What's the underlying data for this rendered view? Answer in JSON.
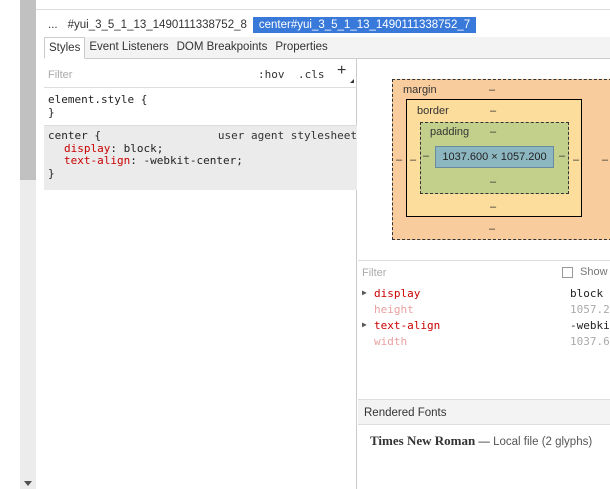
{
  "breadcrumbs": {
    "ellipsis": "...",
    "items": [
      {
        "label": "#yui_3_5_1_13_1490111338752_8"
      },
      {
        "label": "center#yui_3_5_1_13_1490111338752_7"
      }
    ]
  },
  "tabs": [
    {
      "label": "Styles"
    },
    {
      "label": "Event Listeners"
    },
    {
      "label": "DOM Breakpoints"
    },
    {
      "label": "Properties"
    }
  ],
  "styles": {
    "filter_placeholder": "Filter",
    "hov_label": ":hov",
    "cls_label": ".cls",
    "plus_label": "+",
    "element_style": {
      "selector": "element.style {",
      "close": "}"
    },
    "rule": {
      "selector": "center {",
      "origin": "user agent stylesheet",
      "props": [
        {
          "name": "display",
          "value": "block;"
        },
        {
          "name": "text-align",
          "value": "-webkit-center;"
        }
      ],
      "close": "}"
    }
  },
  "box_model": {
    "margin_label": "margin",
    "border_label": "border",
    "padding_label": "padding",
    "dash": "–",
    "content": "1037.600 × 1057.200"
  },
  "computed": {
    "filter_placeholder": "Filter",
    "show_all_label": "Show",
    "rows": [
      {
        "name": "display",
        "value": "block"
      },
      {
        "name": "height",
        "value": "1057.2"
      },
      {
        "name": "text-align",
        "value": "-webki"
      },
      {
        "name": "width",
        "value": "1037.6"
      }
    ]
  },
  "rendered_fonts": {
    "title": "Rendered Fonts",
    "font_name": "Times New Roman",
    "separator": " — ",
    "source": "Local file ",
    "glyphs": "(2 glyphs)"
  }
}
